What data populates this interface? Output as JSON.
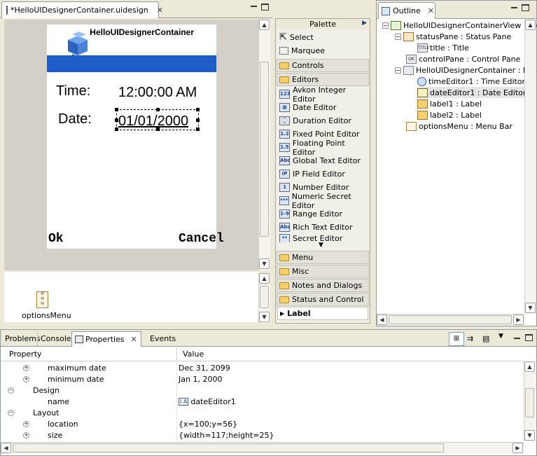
{
  "editor": {
    "tab_title": "*HelloUIDesignerContainer.uidesign",
    "phone": {
      "title": "HelloUIDesignerContainer",
      "time_label": "Time:",
      "time_value": "12:00:00 AM",
      "date_label": "Date:",
      "date_value": "01/01/2000",
      "left_softkey": "Ok",
      "right_softkey": "Cancel"
    },
    "nonvisual_item": "optionsMenu"
  },
  "palette": {
    "title": "Palette",
    "tools": [
      {
        "label": "Select",
        "icon": "arrow-cursor-icon"
      },
      {
        "label": "Marquee",
        "icon": "marquee-icon"
      }
    ],
    "drawers_top": [
      "Controls",
      "Editors"
    ],
    "editors": [
      {
        "label": "Avkon Integer Editor",
        "icon_text": "123"
      },
      {
        "label": "Date Editor",
        "icon_text": "▦"
      },
      {
        "label": "Duration Editor",
        "icon_text": "⌚"
      },
      {
        "label": "Fixed Point Editor",
        "icon_text": "1.2"
      },
      {
        "label": "Floating Point Editor",
        "icon_text": "1.5"
      },
      {
        "label": "Global Text Editor",
        "icon_text": "Abc"
      },
      {
        "label": "IP Field Editor",
        "icon_text": "IP"
      },
      {
        "label": "Number Editor",
        "icon_text": "1"
      },
      {
        "label": "Numeric Secret Editor",
        "icon_text": "***"
      },
      {
        "label": "Range Editor",
        "icon_text": "1-9"
      },
      {
        "label": "Rich Text Editor",
        "icon_text": "Abc"
      },
      {
        "label": "Secret Editor",
        "icon_text": "**"
      }
    ],
    "drawers_bottom": [
      "Menu",
      "Misc",
      "Notes and Dialogs",
      "Status and Control"
    ],
    "label_item": "Label"
  },
  "outline": {
    "tab_title": "Outline",
    "items": [
      {
        "label": "HelloUIDesignerContainerView : Avkon",
        "icon": "view-icon"
      },
      {
        "label": "statusPane : Status Pane",
        "icon": "status-pane-icon"
      },
      {
        "label": "title : Title",
        "icon": "title-icon",
        "icon_text": "TITLE"
      },
      {
        "label": "controlPane : Control Pane",
        "icon": "control-pane-icon",
        "icon_text": "OK"
      },
      {
        "label": "HelloUIDesignerContainer : Basic C",
        "icon": "container-icon"
      },
      {
        "label": "timeEditor1 : Time Editor",
        "icon": "clock-icon"
      },
      {
        "label": "dateEditor1 : Date Editor",
        "icon": "calendar-icon"
      },
      {
        "label": "label1 : Label",
        "icon": "label-icon"
      },
      {
        "label": "label2 : Label",
        "icon": "label-icon"
      },
      {
        "label": "optionsMenu : Menu Bar",
        "icon": "menu-bar-icon"
      }
    ]
  },
  "bottom": {
    "tabs": [
      "Problems",
      "Console",
      "Properties",
      "Events"
    ],
    "columns": {
      "property": "Property",
      "value": "Value"
    },
    "rows": [
      {
        "property": "maximum date",
        "value": "Dec 31, 2099",
        "indent": 2
      },
      {
        "property": "minimum date",
        "value": "Jan 1, 2000",
        "indent": 2
      },
      {
        "property": "Design",
        "value": "",
        "indent": 1
      },
      {
        "property": "name",
        "value": "dateEditor1",
        "indent": 2
      },
      {
        "property": "Layout",
        "value": "",
        "indent": 1
      },
      {
        "property": "location",
        "value": "{x=100;y=56}",
        "indent": 2
      },
      {
        "property": "size",
        "value": "{width=117;height=25}",
        "indent": 2
      }
    ]
  }
}
